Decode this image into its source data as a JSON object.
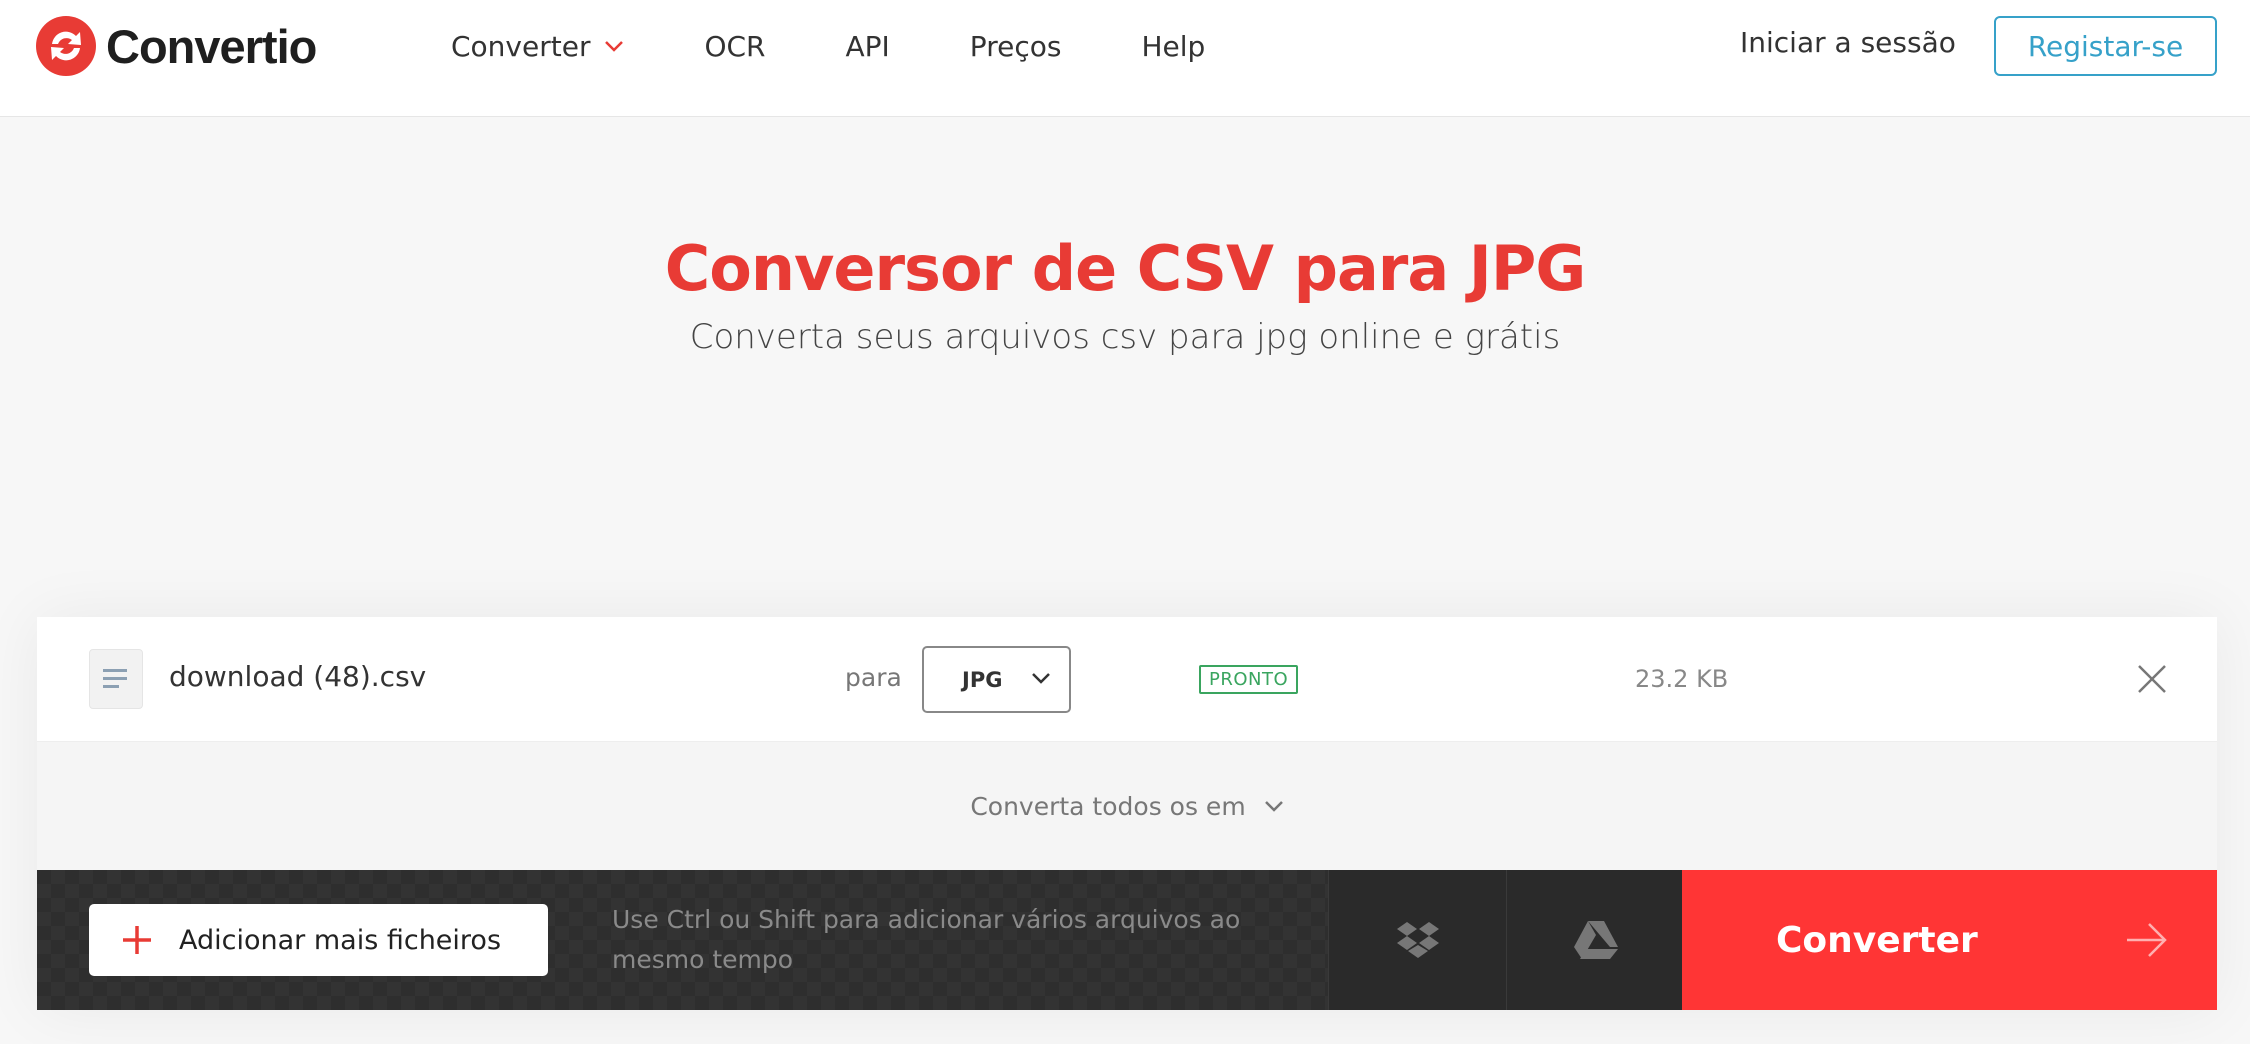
{
  "header": {
    "logo_text": "Convertio",
    "nav": [
      {
        "label": "Converter"
      },
      {
        "label": "OCR"
      },
      {
        "label": "API"
      },
      {
        "label": "Preços"
      },
      {
        "label": "Help"
      }
    ],
    "login_label": "Iniciar a sessão",
    "register_label": "Registar-se"
  },
  "hero": {
    "title": "Conversor de CSV para JPG",
    "subtitle": "Converta seus arquivos csv para jpg online e grátis"
  },
  "converter": {
    "file": {
      "name": "download (48).csv",
      "to_label": "para",
      "format": "JPG",
      "status": "PRONTO",
      "size": "23.2 KB"
    },
    "convert_all_label": "Converta todos os em",
    "add_files_label": "Adicionar mais ficheiros",
    "hint": "Use Ctrl ou Shift para adicionar vários arquivos ao mesmo tempo",
    "convert_label": "Converter"
  },
  "colors": {
    "brand_red": "#e83b35",
    "convert_red": "#ff3535",
    "register_blue": "#36a1c9",
    "ready_green": "#3aa55f"
  },
  "icons": [
    "convertio-logo-icon",
    "chevron-down-icon",
    "file-icon",
    "close-icon",
    "plus-icon",
    "dropbox-icon",
    "google-drive-icon",
    "arrow-right-icon"
  ]
}
